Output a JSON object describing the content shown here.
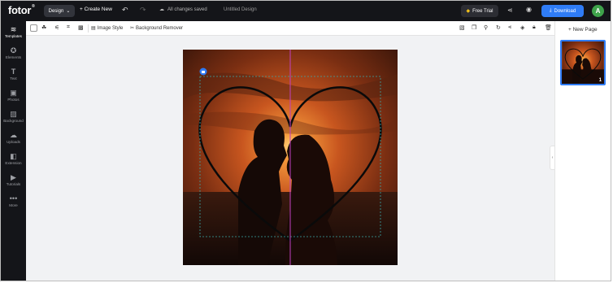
{
  "header": {
    "logo": "fotor",
    "logo_mark": "®",
    "design_label": "Design",
    "create_new_label": "Create New",
    "save_status": "All changes saved",
    "doc_title": "Untitled Design",
    "free_trial_label": "Free Trial",
    "download_label": "Download",
    "avatar_initial": "A"
  },
  "sidebar": {
    "items": [
      {
        "label": "Templates",
        "icon": "templates-icon",
        "glyph": "≋"
      },
      {
        "label": "Elements",
        "icon": "elements-icon",
        "glyph": "✪"
      },
      {
        "label": "Text",
        "icon": "text-icon",
        "glyph": "T"
      },
      {
        "label": "Photos",
        "icon": "photos-icon",
        "glyph": "▣"
      },
      {
        "label": "Background",
        "icon": "background-icon",
        "glyph": "▨"
      },
      {
        "label": "Uploads",
        "icon": "uploads-icon",
        "glyph": "☁"
      },
      {
        "label": "Extension",
        "icon": "extension-icon",
        "glyph": "◧"
      },
      {
        "label": "Tutorials",
        "icon": "tutorials-icon",
        "glyph": "▶"
      },
      {
        "label": "More",
        "icon": "more-icon",
        "glyph": "•••"
      }
    ],
    "active_index": 0
  },
  "toolbar": {
    "image_style_label": "Image Style",
    "background_remover_label": "Background Remover"
  },
  "right_panel": {
    "new_page_label": "New Page",
    "page_number": "1"
  },
  "colors": {
    "topbar_bg": "#141519",
    "accent": "#2f7cf6",
    "selection_guide": "#c040c0",
    "selection_box": "#3aa6a6"
  }
}
